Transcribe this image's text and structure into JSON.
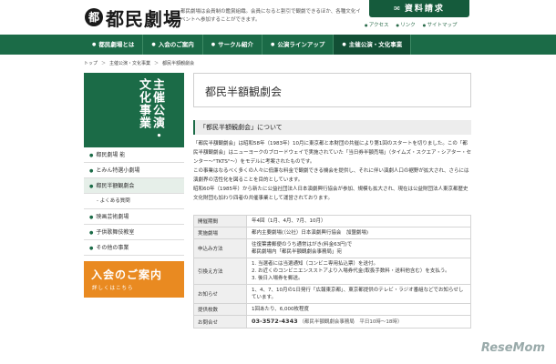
{
  "header": {
    "logo_mark": "都",
    "logo_text": "都民劇場",
    "tagline": "都民劇場は会員制の鑑賞組織。会員になると割引で観劇できるほか、各種文化イベントへ参加することができます。",
    "request_button": "資料請求",
    "links": [
      "アクセス",
      "リンク",
      "サイトマップ"
    ]
  },
  "nav": {
    "items": [
      "都民劇場とは",
      "入会のご案内",
      "サークル紹介",
      "公演ラインアップ",
      "主催公演・文化事業"
    ]
  },
  "breadcrumb": [
    "トップ",
    "主催公演・文化事業",
    "都民半額観劇会"
  ],
  "sidebar": {
    "heading": "主催公演・文化事業",
    "items": [
      {
        "label": "都民劇場 能",
        "type": "item"
      },
      {
        "label": "とみん特選小劇場",
        "type": "item"
      },
      {
        "label": "都民半額観劇会",
        "type": "current"
      },
      {
        "label": "- よくある質問",
        "type": "sub"
      },
      {
        "label": "映画芸術劇場",
        "type": "item"
      },
      {
        "label": "子供歌舞伎教室",
        "type": "item"
      },
      {
        "label": "その他の事業",
        "type": "item"
      }
    ],
    "banner_main": "入会のご案内",
    "banner_sub": "詳しくはこちら"
  },
  "main": {
    "title": "都民半額観劇会",
    "section_title": "「都民半額観劇会」について",
    "paragraphs": [
      "「都民半額観劇会」は昭和58年（1983年）10月に東京都と本財団の共催により第1回のスタートを切りました。この「都民半額観劇会」はニューヨークのブロードウェイで実施されていた「当日券半額売場」（タイムズ・スクエア・シアター・センター〜\"TKTS\"〜）をモデルに考案されたものです。",
      "この事業はなるべく多くの人々に低廉な料金で観劇できる機会を提供し、それに伴い演劇人口の裾野が拡大され、さらには演劇界の活性化を図ることを目的としています。",
      "昭和60年（1985年）から新たに公益社団法人日本演劇興行協会が参加、規模も拡大され、現在は公益財団法人東京都歴史文化財団も加わり四者の共催事業として運営されております。"
    ],
    "table": [
      {
        "label": "開催期間",
        "lines": [
          "年4回（1月、4月、7月、10月）"
        ]
      },
      {
        "label": "実施劇場",
        "lines": [
          "都内主要劇場(（公社）日本演劇興行協会　加盟劇場)"
        ]
      },
      {
        "label": "申込み方法",
        "lines": [
          "往復葉書郵便のうち通常はがき(料金63円)で",
          "都民劇場内「都民半額観劇会事務局」宛"
        ]
      },
      {
        "label": "引換え方法",
        "lines": [
          "1. 当選者には当選通知（コンビニ専用払込票）を送付。",
          "2. お近くのコンビニエンスストアより入場券代金(取扱手数料・送料他含む）を支払う。",
          "3. 後日入場券を郵送。"
        ]
      },
      {
        "label": "お知らせ",
        "lines": [
          "1、4、7、10月の1日発行「広報東京都」、東京都提供のテレビ・ラジオ番組などでお知らせしています。"
        ]
      },
      {
        "label": "提供枚数",
        "lines": [
          "1回あたり、6,000枚程度"
        ]
      },
      {
        "label": "お問合せ",
        "phone": "03-3572-4343",
        "lines": [
          "（都民半額観劇会事務局　平日10時〜18時）"
        ]
      }
    ]
  },
  "watermark": "ReseMom"
}
